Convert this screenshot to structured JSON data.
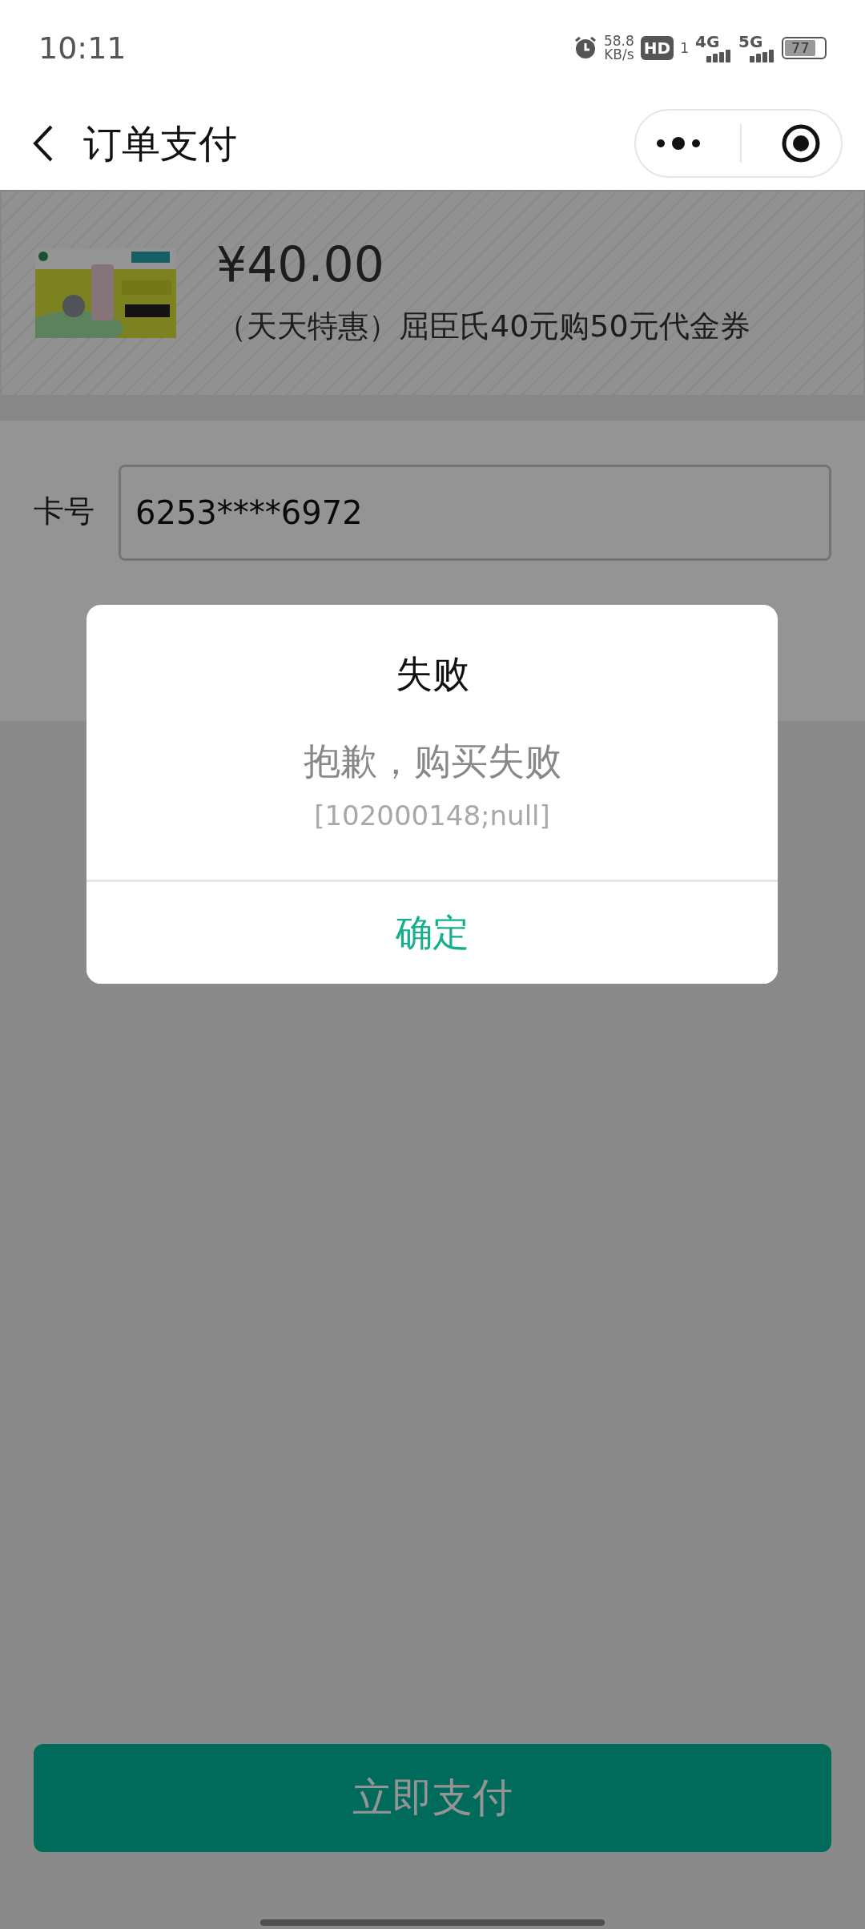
{
  "status_bar": {
    "time": "10:11",
    "net_speed": "58.8",
    "net_speed_unit": "KB/s",
    "hd_label": "HD",
    "sim_index": "1",
    "network_1": "4G",
    "network_2": "5G",
    "battery": "77"
  },
  "nav": {
    "title": "订单支付"
  },
  "product": {
    "price": "¥40.00",
    "name": "（天天特惠）屈臣氏40元购50元代金券"
  },
  "form": {
    "label": "卡号",
    "value": "6253****6972"
  },
  "pay_button": "立即支付",
  "dialog": {
    "title": "失败",
    "message": "抱歉，购买失败",
    "code": "[102000148;null]",
    "button": "确定"
  }
}
